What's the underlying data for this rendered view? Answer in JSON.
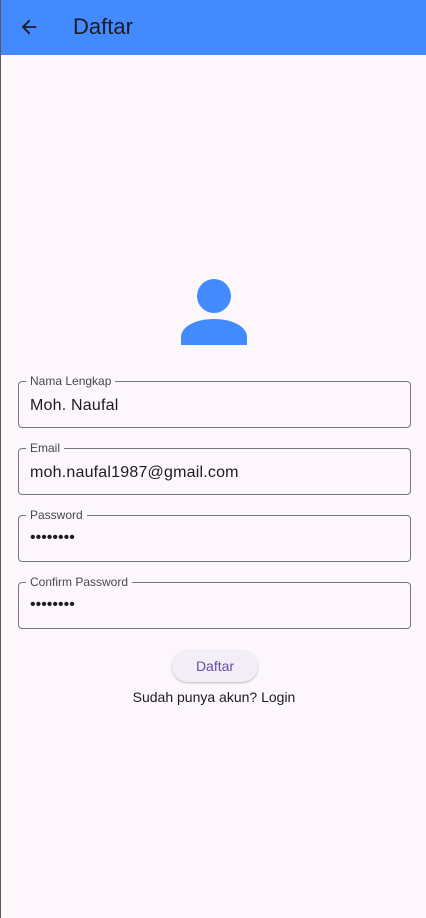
{
  "colors": {
    "appbar": "#448aff",
    "background": "#fdf7fc",
    "avatar": "#448aff",
    "outline": "#79747e",
    "button_text": "#6750a4"
  },
  "appbar": {
    "back_icon": "arrow-back-icon",
    "title": "Daftar"
  },
  "avatar_icon": "person-icon",
  "form": {
    "name": {
      "label": "Nama Lengkap",
      "value": "Moh. Naufal"
    },
    "email": {
      "label": "Email",
      "value": "moh.naufal1987@gmail.com"
    },
    "password": {
      "label": "Password",
      "value": "••••••••"
    },
    "confirm_password": {
      "label": "Confirm Password",
      "value": "••••••••"
    }
  },
  "submit_label": "Daftar",
  "login_link": "Sudah punya akun? Login"
}
